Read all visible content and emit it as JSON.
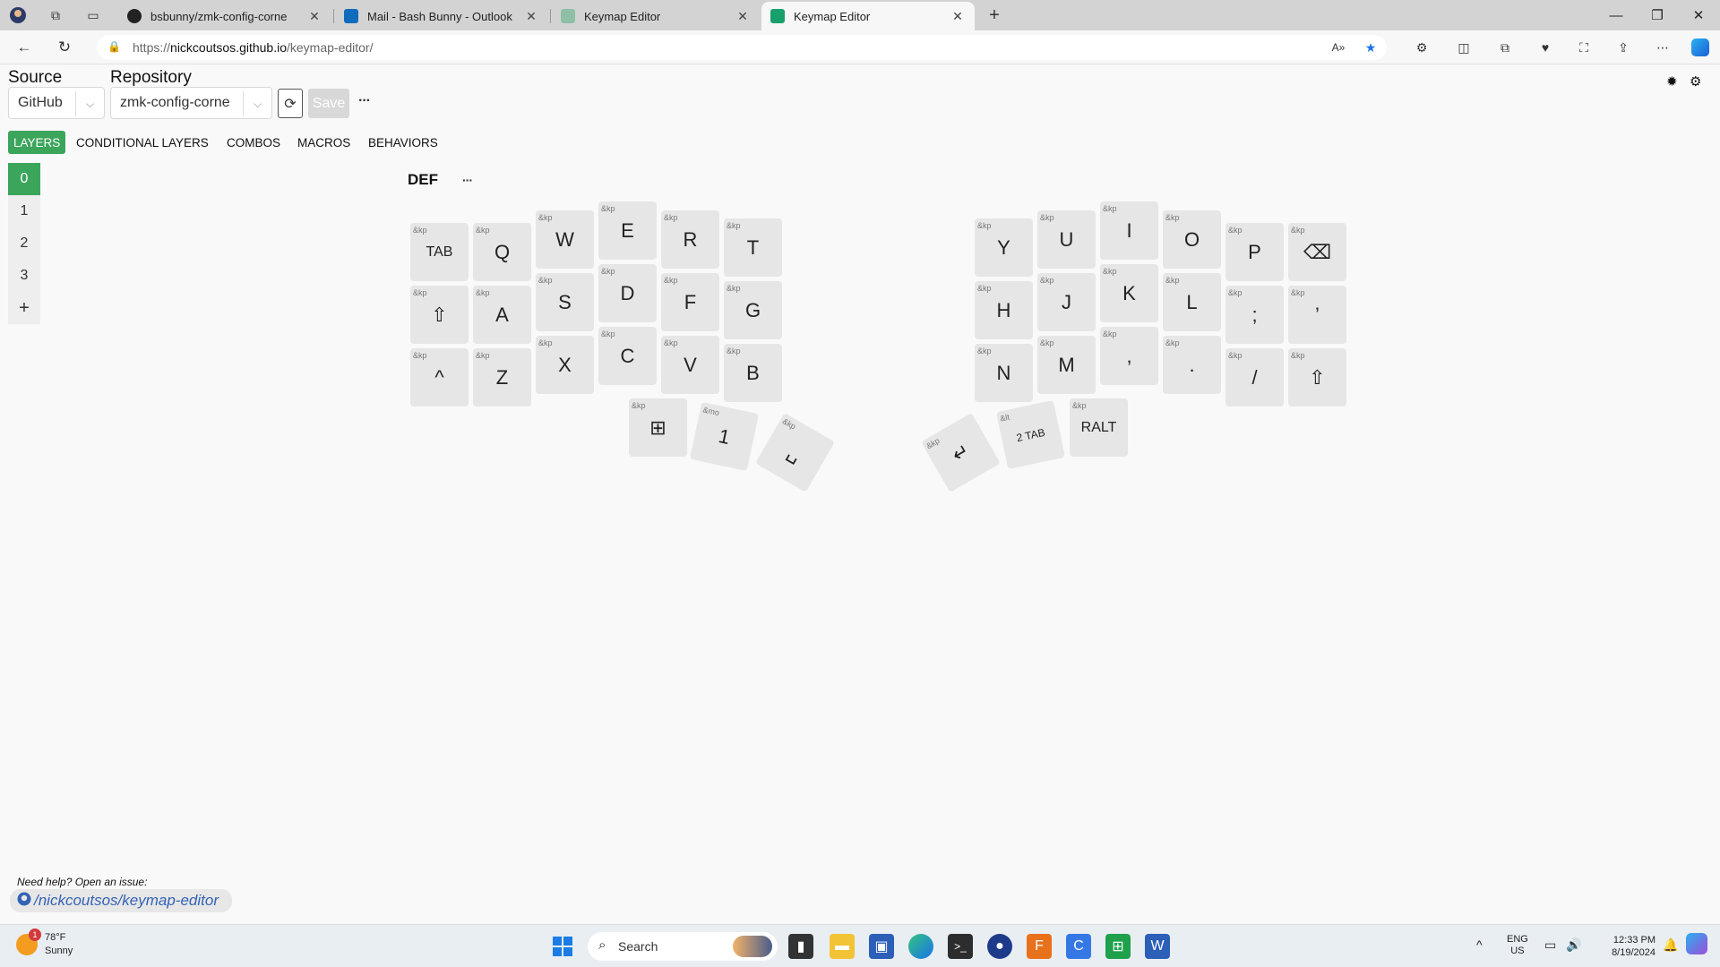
{
  "browser": {
    "tabs": [
      {
        "label": "bsbunny/zmk-config-corne",
        "icon": "github-icon"
      },
      {
        "label": "Mail - Bash Bunny - Outlook",
        "icon": "outlook-icon"
      },
      {
        "label": "Keymap Editor",
        "icon": "keymap-editor-icon"
      },
      {
        "label": "Keymap Editor",
        "icon": "keymap-editor-icon"
      }
    ],
    "new_tab": "+",
    "url_prefix": "https://",
    "url_host": "nickcoutsos.github.io",
    "url_path": "/keymap-editor/"
  },
  "app": {
    "source_label": "Source",
    "repository_label": "Repository",
    "source_value": "GitHub",
    "repository_value": "zmk-config-corne",
    "save_label": "Save",
    "more_label": "···",
    "nav_tabs": [
      "LAYERS",
      "CONDITIONAL LAYERS",
      "COMBOS",
      "MACROS",
      "BEHAVIORS"
    ],
    "layers": [
      "0",
      "1",
      "2",
      "3",
      "+"
    ],
    "layer_title": "DEF",
    "layer_more": "···"
  },
  "keys": [
    {
      "b": "&kp",
      "l": "TAB"
    },
    {
      "b": "&kp",
      "l": "Q"
    },
    {
      "b": "&kp",
      "l": "W"
    },
    {
      "b": "&kp",
      "l": "E"
    },
    {
      "b": "&kp",
      "l": "R"
    },
    {
      "b": "&kp",
      "l": "T"
    },
    {
      "b": "&kp",
      "l": "Y"
    },
    {
      "b": "&kp",
      "l": "U"
    },
    {
      "b": "&kp",
      "l": "I"
    },
    {
      "b": "&kp",
      "l": "O"
    },
    {
      "b": "&kp",
      "l": "P"
    },
    {
      "b": "&kp",
      "l": "⌫"
    },
    {
      "b": "&kp",
      "l": "⇧"
    },
    {
      "b": "&kp",
      "l": "A"
    },
    {
      "b": "&kp",
      "l": "S"
    },
    {
      "b": "&kp",
      "l": "D"
    },
    {
      "b": "&kp",
      "l": "F"
    },
    {
      "b": "&kp",
      "l": "G"
    },
    {
      "b": "&kp",
      "l": "H"
    },
    {
      "b": "&kp",
      "l": "J"
    },
    {
      "b": "&kp",
      "l": "K"
    },
    {
      "b": "&kp",
      "l": "L"
    },
    {
      "b": "&kp",
      "l": ";"
    },
    {
      "b": "&kp",
      "l": "’"
    },
    {
      "b": "&kp",
      "l": "^"
    },
    {
      "b": "&kp",
      "l": "Z"
    },
    {
      "b": "&kp",
      "l": "X"
    },
    {
      "b": "&kp",
      "l": "C"
    },
    {
      "b": "&kp",
      "l": "V"
    },
    {
      "b": "&kp",
      "l": "B"
    },
    {
      "b": "&kp",
      "l": "N"
    },
    {
      "b": "&kp",
      "l": "M"
    },
    {
      "b": "&kp",
      "l": ","
    },
    {
      "b": "&kp",
      "l": "."
    },
    {
      "b": "&kp",
      "l": "/"
    },
    {
      "b": "&kp",
      "l": "⇧"
    },
    {
      "b": "&kp",
      "l": "⊞"
    },
    {
      "b": "&mo",
      "l": "1"
    },
    {
      "b": "&kp",
      "l": "␣"
    },
    {
      "b": "&kp",
      "l": "↵"
    },
    {
      "b": "&lt",
      "l": "2 TAB"
    },
    {
      "b": "&kp",
      "l": "RALT"
    }
  ],
  "footer": {
    "help_text": "Need help? Open an issue:",
    "link_text": "/nickcoutsos/keymap-editor"
  },
  "taskbar": {
    "weather_temp": "78°F",
    "weather_desc": "Sunny",
    "weather_badge": "1",
    "search_label": "Search",
    "lang": "ENG",
    "region": "US",
    "time": "12:33 PM",
    "date": "8/19/2024"
  }
}
